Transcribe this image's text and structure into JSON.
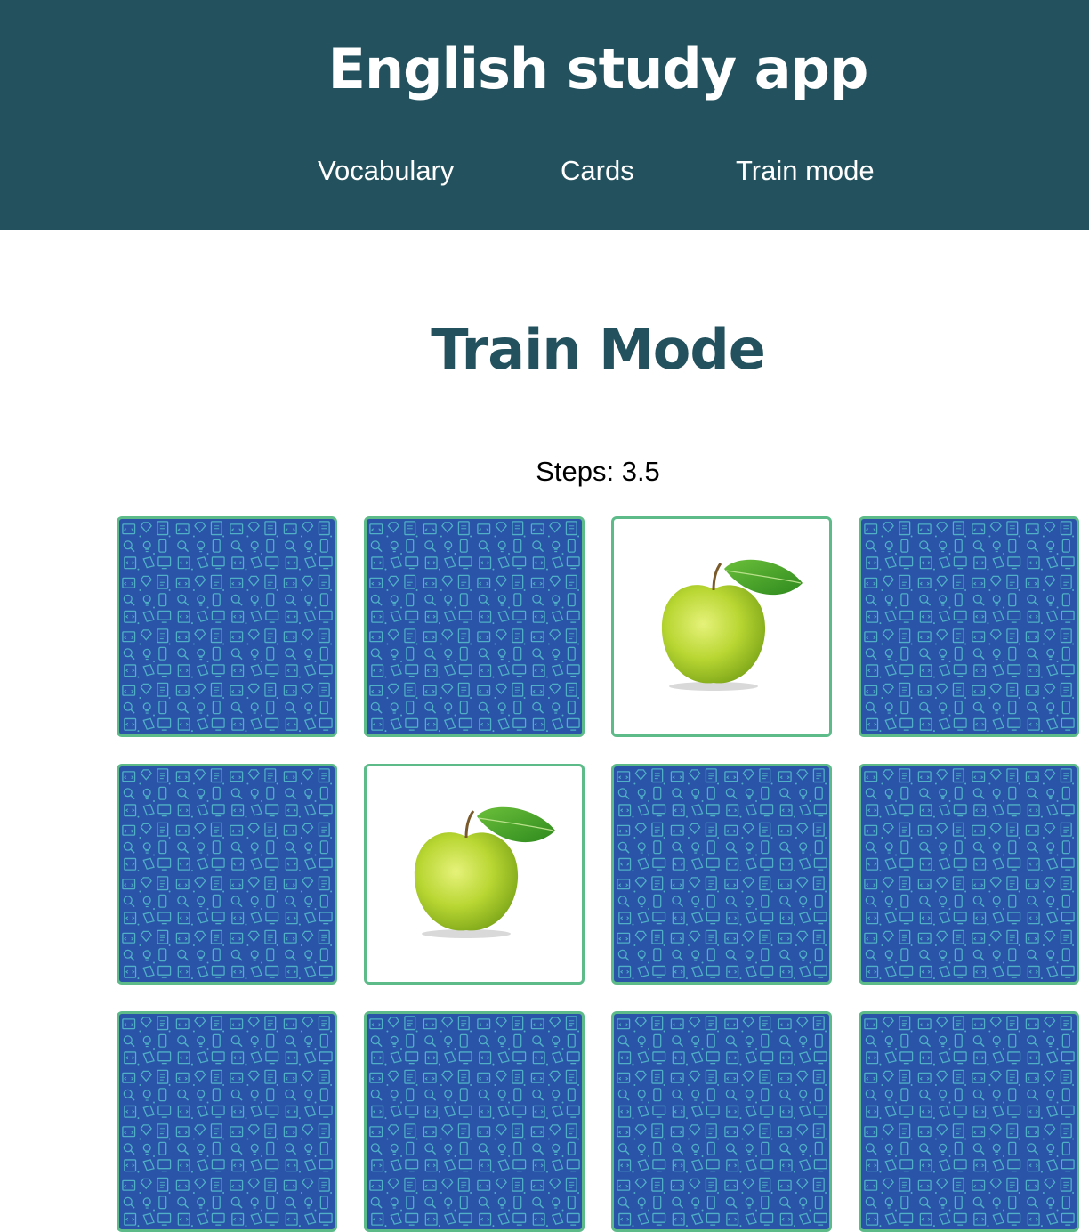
{
  "header": {
    "title": "English study app",
    "nav": [
      {
        "label": "Vocabulary"
      },
      {
        "label": "Cards"
      },
      {
        "label": "Train mode"
      }
    ]
  },
  "main": {
    "title": "Train Mode",
    "steps_label": "Steps:",
    "steps_value": "3.5"
  },
  "colors": {
    "header_bg": "#23525e",
    "card_border": "#5dbb8a",
    "card_back": "#2a54a8",
    "pattern_stroke": "#4fb0c6"
  },
  "cards": [
    {
      "state": "face-down"
    },
    {
      "state": "face-down"
    },
    {
      "state": "face-up",
      "image": "apple-icon"
    },
    {
      "state": "face-down"
    },
    {
      "state": "face-down"
    },
    {
      "state": "face-up",
      "image": "apple-icon"
    },
    {
      "state": "face-down"
    },
    {
      "state": "face-down"
    },
    {
      "state": "face-down"
    },
    {
      "state": "face-down"
    },
    {
      "state": "face-down"
    },
    {
      "state": "face-down"
    }
  ]
}
